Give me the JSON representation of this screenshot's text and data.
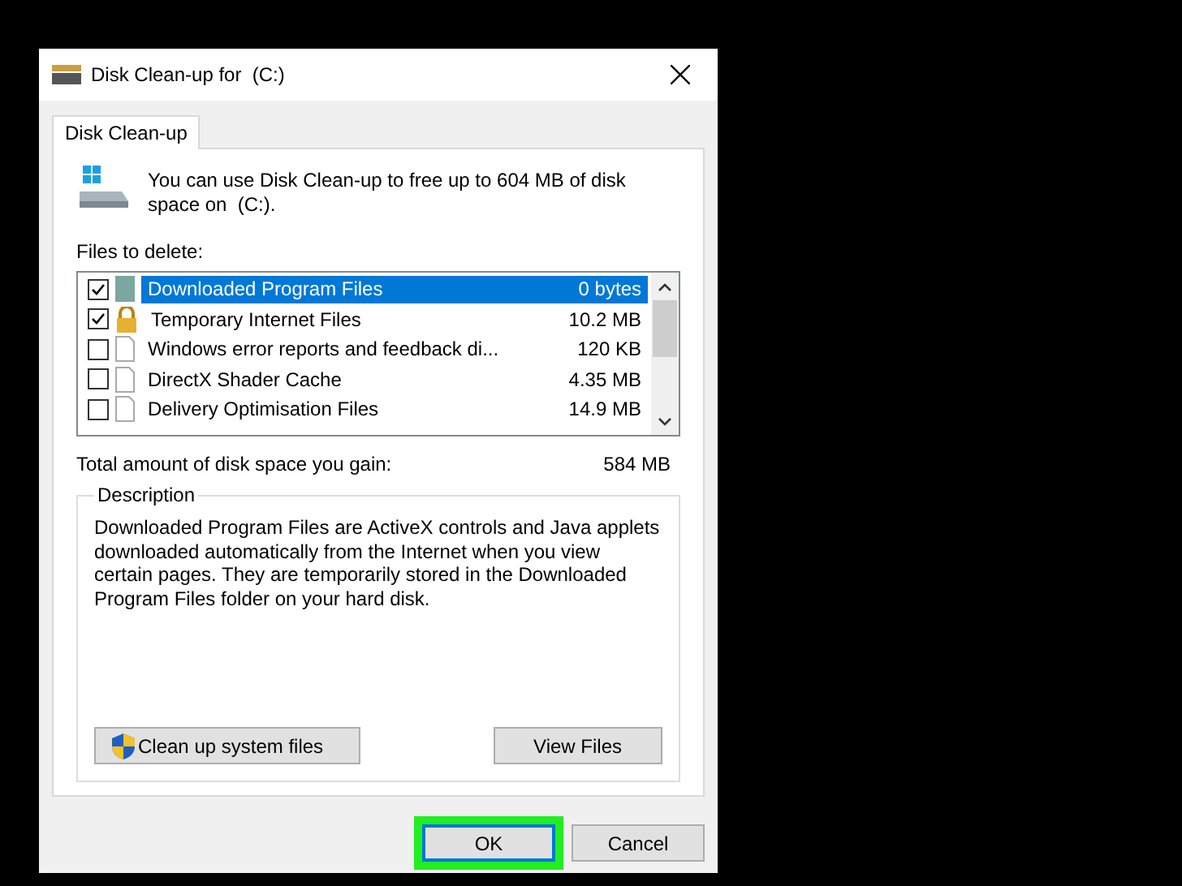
{
  "window": {
    "title": "Disk Clean-up for  (C:)"
  },
  "tabs": [
    {
      "label": "Disk Clean-up",
      "selected": true
    }
  ],
  "intro": "You can use Disk Clean-up to free up to 604 MB of disk space on  (C:).",
  "files_label": "Files to delete:",
  "files": [
    {
      "name": "Downloaded Program Files",
      "size": "0 bytes",
      "checked": true,
      "selected": true,
      "kind": "program"
    },
    {
      "name": "Temporary Internet Files",
      "size": "10.2 MB",
      "checked": true,
      "selected": false,
      "kind": "lock"
    },
    {
      "name": "Windows error reports and feedback di...",
      "size": "120 KB",
      "checked": false,
      "selected": false,
      "kind": "document"
    },
    {
      "name": "DirectX Shader Cache",
      "size": "4.35 MB",
      "checked": false,
      "selected": false,
      "kind": "document"
    },
    {
      "name": "Delivery Optimisation Files",
      "size": "14.9 MB",
      "checked": false,
      "selected": false,
      "kind": "document"
    }
  ],
  "total": {
    "label": "Total amount of disk space you gain:",
    "value": "584 MB"
  },
  "description": {
    "title": "Description",
    "text": "Downloaded Program Files are ActiveX controls and Java applets downloaded automatically from the Internet when you view certain pages. They are temporarily stored in the Downloaded Program Files folder on your hard disk."
  },
  "actions": [
    {
      "label": "Clean up system files",
      "kind": "shield"
    },
    {
      "label": "View Files",
      "kind": "plain"
    }
  ],
  "buttons": [
    {
      "label": "OK",
      "default": true,
      "highlighted": true
    },
    {
      "label": "Cancel",
      "default": false,
      "highlighted": false
    }
  ]
}
